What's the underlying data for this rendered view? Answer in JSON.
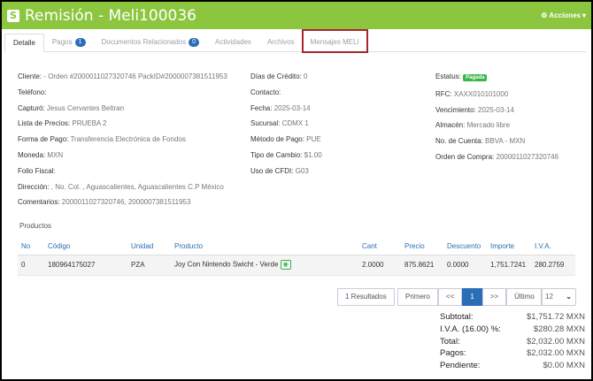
{
  "header": {
    "logo_glyph": "S",
    "title": "Remisión - Meli100036",
    "actions_label": "Acciones"
  },
  "tabs": [
    {
      "label": "Detalle"
    },
    {
      "label": "Pagos",
      "badge": "1"
    },
    {
      "label": "Documentos Relacionados",
      "badge": "0"
    },
    {
      "label": "Actividades"
    },
    {
      "label": "Archivos"
    },
    {
      "label": "Mensajes MELI"
    }
  ],
  "col1": [
    {
      "k": "Cliente:",
      "v": " - Orden #2000011027320746 PackID#2000007381511953"
    },
    {
      "k": "Teléfono:",
      "v": ""
    },
    {
      "k": "Capturó:",
      "v": " Jesus Cervantes Beltran"
    },
    {
      "k": "Lista de Precios:",
      "v": " PRUEBA 2"
    },
    {
      "k": "Forma de Pago:",
      "v": " Transferencia Electrónica de Fondos"
    },
    {
      "k": "Moneda:",
      "v": " MXN"
    },
    {
      "k": "Folio Fiscal:",
      "v": ""
    },
    {
      "k": "Dirección:",
      "v": " , No. Col. , Aguascalientes, Aguascalientes C.P México"
    },
    {
      "k": "Comentarios:",
      "v": " 2000011027320746, 2000007381511953"
    }
  ],
  "col2": [
    {
      "k": "Días de Crédito:",
      "v": " 0"
    },
    {
      "k": "Contacto:",
      "v": ""
    },
    {
      "k": "Fecha:",
      "v": " 2025-03-14"
    },
    {
      "k": "Sucursal:",
      "v": " CDMX 1"
    },
    {
      "k": "Método de Pago:",
      "v": " PUE"
    },
    {
      "k": "Tipo de Cambio:",
      "v": " $1.00"
    },
    {
      "k": "Uso de CFDI:",
      "v": " G03"
    }
  ],
  "col3": [
    {
      "k": "Estatus:",
      "v": ""
    },
    {
      "k": "RFC:",
      "v": " XAXX010101000"
    },
    {
      "k": "Vencimiento:",
      "v": " 2025-03-14"
    },
    {
      "k": "Almacén:",
      "v": " Mercado libre"
    },
    {
      "k": "No. de Cuenta:",
      "v": " BBVA - MXN"
    },
    {
      "k": "Orden de Compra:",
      "v": " 2000011027320746"
    }
  ],
  "status_badge": "Pagada",
  "products": {
    "title": "Productos",
    "headers": [
      "No",
      "Código",
      "Unidad",
      "Producto",
      "Cant",
      "Precio",
      "Descuento",
      "Importe",
      "I.V.A."
    ],
    "rows": [
      [
        "0",
        "180964175027",
        "PZA",
        "Joy Con Nintendo Swicht - Verde",
        "2.0000",
        "875.8621",
        "0.0000",
        "1,751.7241",
        "280.2759"
      ]
    ],
    "view_icon": "eye-icon"
  },
  "pager": {
    "results": "1 Resultados",
    "first": "Primero",
    "prev": "<<",
    "current": "1",
    "next": ">>",
    "last": "Último",
    "page_size": "12"
  },
  "totals": [
    {
      "label": "Subtotal:",
      "value": "$1,751.72 MXN"
    },
    {
      "label": "I.V.A. (16.00) %:",
      "value": "$280.28 MXN"
    },
    {
      "label": "Total:",
      "value": "$2,032.00 MXN"
    },
    {
      "label": "Pagos:",
      "value": "$2,032.00 MXN"
    },
    {
      "label": "Pendiente:",
      "value": "$0.00 MXN"
    }
  ],
  "colors": {
    "brand": "#8cc63f",
    "accent": "#2a6fb5",
    "paid": "#3ab54a",
    "highlight": "#a6282d"
  }
}
